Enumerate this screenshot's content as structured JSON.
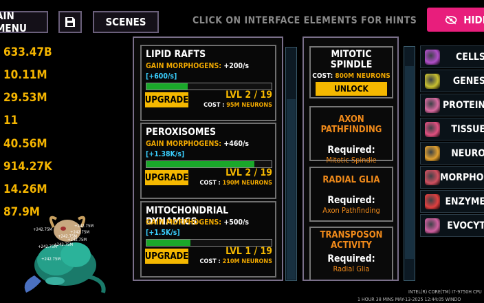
{
  "topbar": {
    "main_menu": "AIN MENU",
    "scenes": "SCENES",
    "hint": "CLICK ON INTERFACE ELEMENTS FOR HINTS",
    "hide": "HIDE"
  },
  "stats": [
    "633.47B",
    "10.11M",
    "29.53M",
    "11",
    "40.56M",
    "914.27K",
    "14.26M",
    "87.9M"
  ],
  "upgrades": [
    {
      "name": "LIPID RAFTS",
      "gain_label": "GAIN MORPHOGENS:",
      "gain": "+200/s",
      "rate": "[+600/s]",
      "progress": 0.33,
      "button": "UPGRADE",
      "level": "LVL 2 / 19",
      "cost_label": "COST :",
      "cost": "95M NEURONS"
    },
    {
      "name": "PEROXISOMES",
      "gain_label": "GAIN MORPHOGENS:",
      "gain": "+460/s",
      "rate": "[+1.38K/s]",
      "progress": 0.86,
      "button": "UPGRADE",
      "level": "LVL 2 / 19",
      "cost_label": "COST :",
      "cost": "190M NEURONS"
    },
    {
      "name": "MITOCHONDRIAL DYNAMICS",
      "gain_label": "GAIN MORPHOGENS:",
      "gain": "+500/s",
      "rate": "[+1.5K/s]",
      "progress": 0.35,
      "button": "UPGRADE",
      "level": "LVL 1 / 19",
      "cost_label": "COST :",
      "cost": "210M NEURONS"
    }
  ],
  "research": {
    "mitotic": {
      "title1": "MITOTIC",
      "title2": "SPINDLE",
      "cost_label": "COST:",
      "cost": "800M NEURONS",
      "button": "UNLOCK"
    },
    "axon": {
      "title": "AXON PATHFINDING",
      "req": "Required:",
      "req_name": "Mitotic Spindle"
    },
    "radial": {
      "title": "RADIAL GLIA",
      "req": "Required:",
      "req_name": "Axon Pathfinding"
    },
    "transposon": {
      "title1": "TRANSPOSON",
      "title2": "ACTIVITY",
      "req": "Required:",
      "req_name": "Radial Glia"
    }
  },
  "sidebar": [
    {
      "label": "CELLS",
      "color": "#b04ec8"
    },
    {
      "label": "GENES",
      "color": "#c8c030"
    },
    {
      "label": "PROTEIN",
      "color": "#d86aa0"
    },
    {
      "label": "TISSUE",
      "color": "#e05080"
    },
    {
      "label": "NEURO",
      "color": "#e0a030"
    },
    {
      "label": "MORPHOG",
      "color": "#d05060"
    },
    {
      "label": "ENZYME",
      "color": "#e04040"
    },
    {
      "label": "EVOCYT",
      "color": "#d060a0"
    }
  ],
  "floating_numbers": [
    "+242.75M",
    "+242.75M",
    "+242.75M",
    "+242.75M",
    "+242.75M",
    "+242.75M",
    "+242.75M",
    "+242.75M"
  ],
  "system": {
    "cpu": "INTEL(R) CORE(TM) I7-9750H CPU",
    "time": "1 HOUR 38 MINS   MAY-13-2025 12:44:05   WINDO"
  }
}
